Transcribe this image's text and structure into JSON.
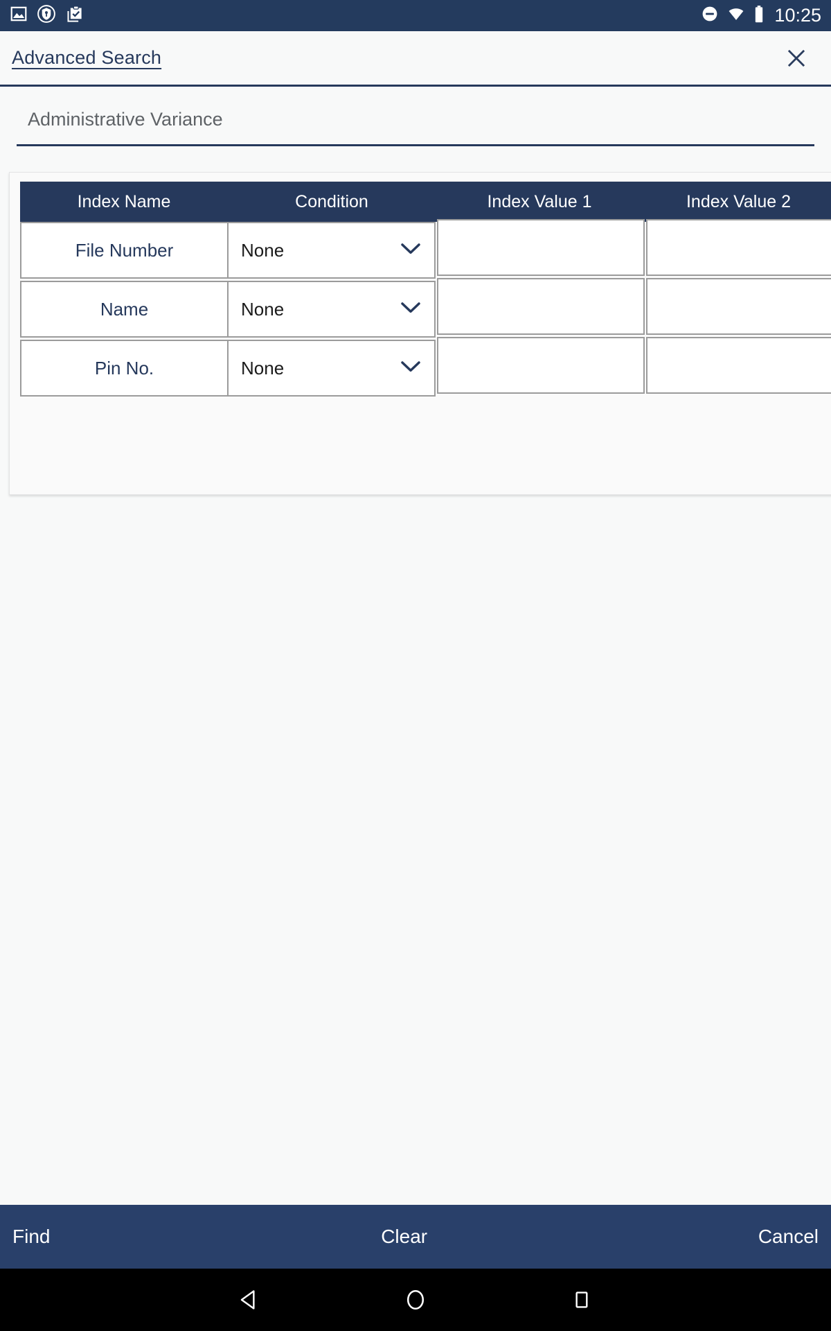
{
  "status_bar": {
    "time": "10:25",
    "left_icons": [
      {
        "name": "image-icon",
        "label": "Screenshot"
      },
      {
        "name": "vpn-key-shield-icon",
        "label": "VPN"
      },
      {
        "name": "clipboard-check-icon",
        "label": "Task complete"
      }
    ],
    "right_icons": [
      {
        "name": "do-not-disturb-icon",
        "label": "Do not disturb"
      },
      {
        "name": "wifi-icon",
        "label": "Wi-Fi"
      },
      {
        "name": "battery-icon",
        "label": "Battery"
      }
    ],
    "background_color": "#243b5e"
  },
  "header": {
    "title": "Advanced Search",
    "close_icon": "close-icon",
    "accent_color": "#26395c"
  },
  "form": {
    "category_value": "Administrative Variance"
  },
  "table": {
    "columns": [
      "Index Name",
      "Condition",
      "Index Value 1",
      "Index Value 2"
    ],
    "rows": [
      {
        "index_name": "File Number",
        "condition": "None",
        "value1": "",
        "value2": ""
      },
      {
        "index_name": "Name",
        "condition": "None",
        "value1": "",
        "value2": ""
      },
      {
        "index_name": "Pin No.",
        "condition": "None",
        "value1": "",
        "value2": ""
      }
    ],
    "header_bg": "#26395c",
    "row_label_color": "#26395c"
  },
  "actions": {
    "find": "Find",
    "clear": "Clear",
    "cancel": "Cancel",
    "bar_color": "#29406a"
  },
  "nav_bar": {
    "back": "back-icon",
    "home": "home-icon",
    "recents": "recents-icon"
  }
}
